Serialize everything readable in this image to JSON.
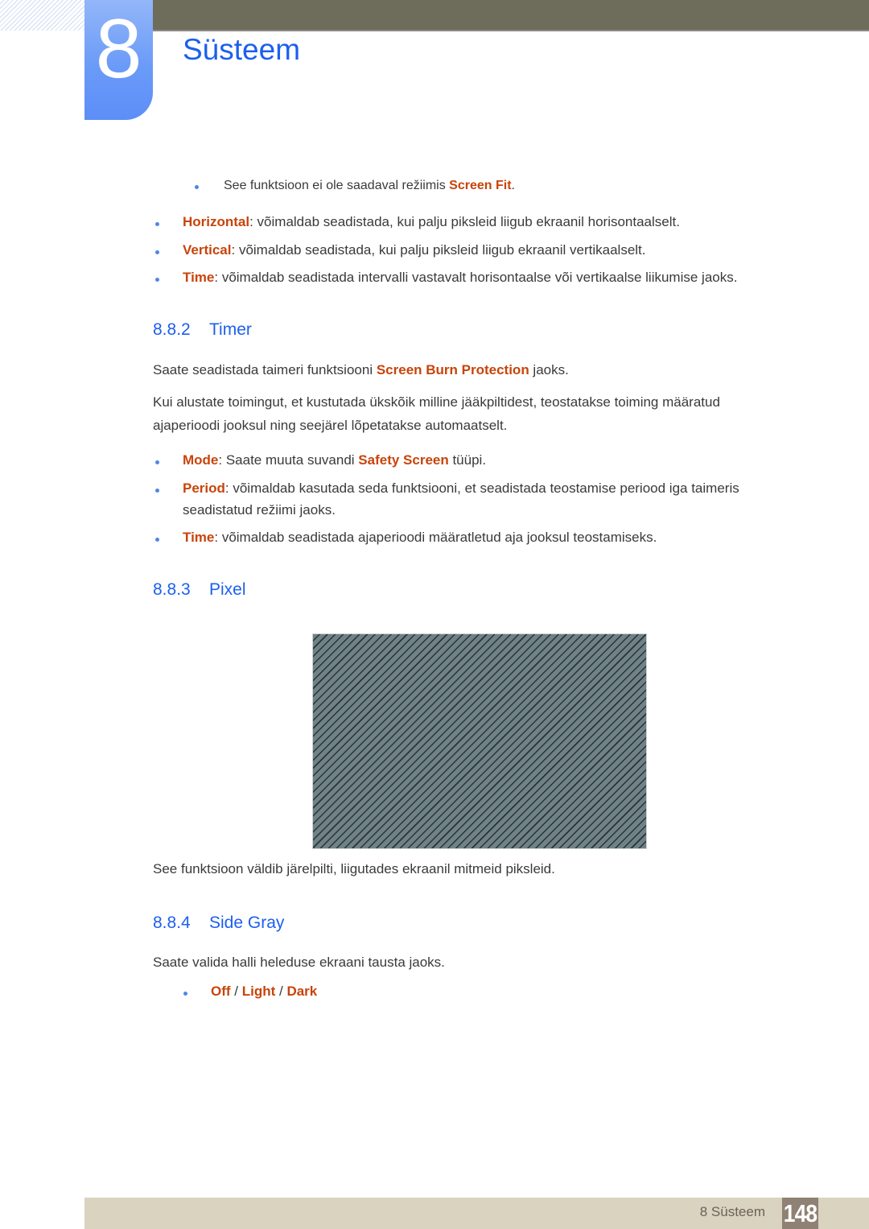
{
  "header": {
    "chapter_number": "8",
    "chapter_title": "Süsteem"
  },
  "note": {
    "text": "See funktsioon ei ole saadaval režiimis ",
    "highlight": "Screen Fit",
    "suffix": "."
  },
  "intro_bullets": [
    {
      "term": "Horizontal",
      "text": ": võimaldab seadistada, kui palju piksleid liigub ekraanil horisontaalselt."
    },
    {
      "term": "Vertical",
      "text": ": võimaldab seadistada, kui palju piksleid liigub ekraanil vertikaalselt."
    },
    {
      "term": "Time",
      "text": ": võimaldab seadistada intervalli vastavalt horisontaalse või vertikaalse liikumise jaoks."
    }
  ],
  "sections": {
    "timer": {
      "number": "8.8.2",
      "title": "Timer",
      "para1_pre": "Saate seadistada taimeri funktsiooni ",
      "para1_highlight": "Screen Burn Protection",
      "para1_post": " jaoks.",
      "para2_line1": "Kui alustate toimingut, et kustutada ükskõik milline jääkpiltidest, teostatakse toiming määratud",
      "para2_line2": "ajaperioodi jooksul ning seejärel lõpetatakse automaatselt.",
      "bullets": [
        {
          "term": "Mode",
          "text": ": Saate muuta suvandi ",
          "highlight": "Safety Screen",
          "post": " tüüpi."
        },
        {
          "term": "Period",
          "text": ": võimaldab kasutada seda funktsiooni, et seadistada teostamise periood iga taimeris",
          "line2": "seadistatud režiimi jaoks."
        },
        {
          "term": "Time",
          "text": ": võimaldab seadistada ajaperioodi määratletud aja jooksul teostamiseks."
        }
      ]
    },
    "pixel": {
      "number": "8.8.3",
      "title": "Pixel",
      "image_label": "pixel-shift-illustration",
      "caption": "See funktsioon väldib järelpilti, liigutades ekraanil mitmeid piksleid."
    },
    "side_gray": {
      "number": "8.8.4",
      "title": "Side Gray",
      "para": "Saate valida halli heleduse ekraani tausta jaoks.",
      "options": [
        "Off",
        "Light",
        "Dark"
      ],
      "separator": " / "
    }
  },
  "footer": {
    "label": "8 Süsteem",
    "page_number": "148"
  },
  "colors": {
    "accent_blue": "#1c5ff0",
    "highlight_orange": "#c8440a",
    "top_bar": "#6e6c5a",
    "footer_bg": "#d9d3c0",
    "page_box": "#8f8174"
  }
}
